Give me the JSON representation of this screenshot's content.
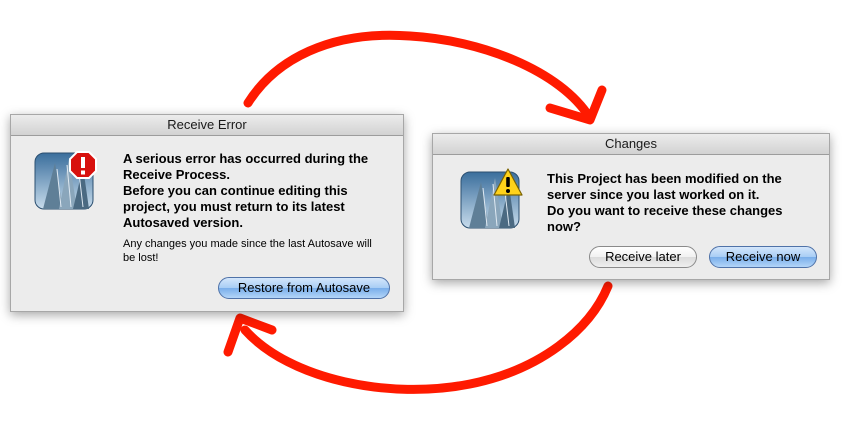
{
  "error_dialog": {
    "title": "Receive Error",
    "message_bold": "A serious error has occurred during the Receive Process.\n Before you can continue editing this project, you must return to its latest Autosaved version.",
    "message_detail": "Any changes you made since the last Autosave will be lost!",
    "restore_button_label": "Restore from Autosave",
    "badge_icon": "stop-error-icon"
  },
  "changes_dialog": {
    "title": "Changes",
    "message_bold": "This Project has been modified on the server since you last worked on it.\nDo you want to receive these changes now?",
    "receive_later_label": "Receive later",
    "receive_now_label": "Receive now",
    "badge_icon": "warning-triangle-icon"
  },
  "annotations": {
    "arrow_color": "#ff1a00"
  }
}
